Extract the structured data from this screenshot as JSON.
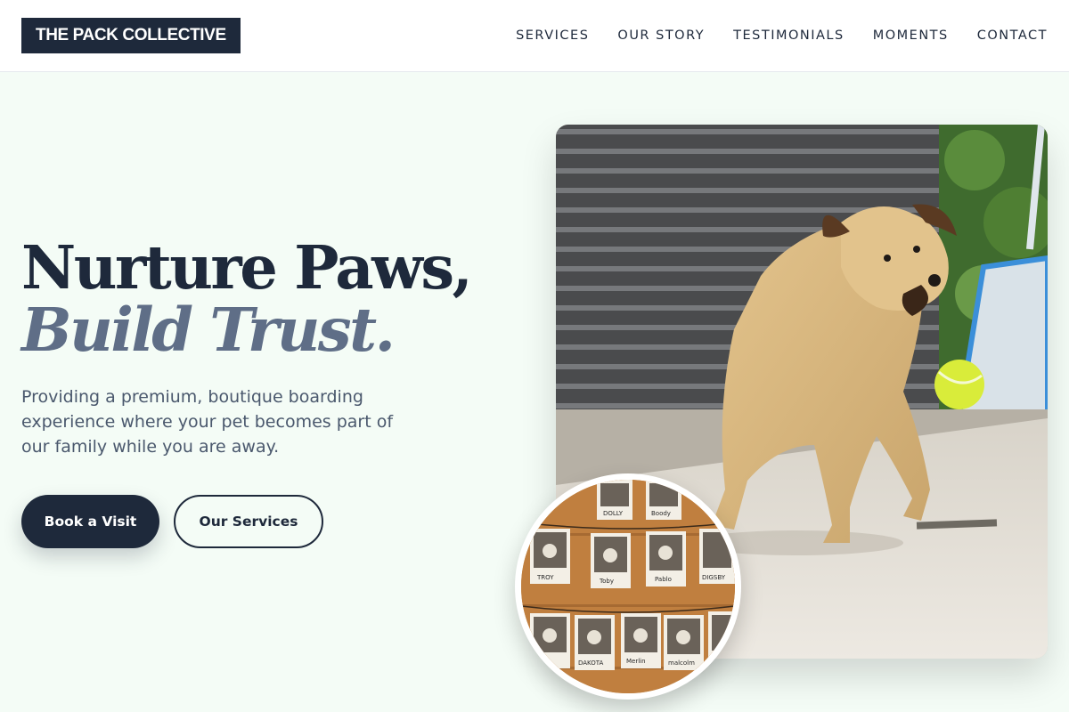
{
  "header": {
    "logo": "THE PACK COLLECTIVE",
    "nav": [
      "SERVICES",
      "OUR STORY",
      "TESTIMONIALS",
      "MOMENTS",
      "CONTACT"
    ]
  },
  "hero": {
    "headline_line1": "Nurture Paws,",
    "headline_line2": "Build Trust.",
    "description": "Providing a premium, boutique boarding experience where your pet becomes part of our family while you are away.",
    "primary_button": "Book a Visit",
    "secondary_button": "Our Services"
  },
  "images": {
    "main": "dog-chasing-tennis-ball-photo",
    "secondary": "pet-polaroid-wall-photo",
    "polaroid_names": [
      "DOLLY",
      "Boody",
      "TROY",
      "Toby",
      "Pablo",
      "DIGSBY",
      "DAKOTA",
      "Merlin",
      "malcolm"
    ]
  },
  "colors": {
    "primary": "#1e293b",
    "accent_text": "#5f6e87",
    "background": "#f4fcf6"
  }
}
